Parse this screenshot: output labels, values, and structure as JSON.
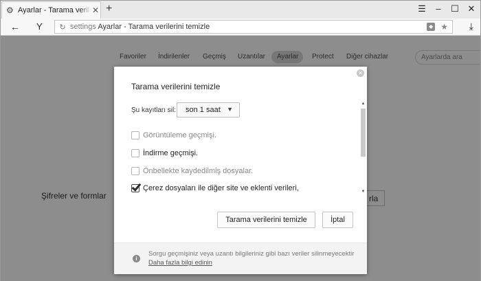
{
  "browser": {
    "tab_title": "Ayarlar - Tarama verilerini",
    "tab_icon": "gear-icon",
    "tab_close": "✕",
    "new_tab": "+",
    "window_controls": [
      "☰",
      "–",
      "☐",
      "✕"
    ],
    "back": "←",
    "yandex_logo": "Y",
    "url_host": "settings",
    "url_title": "Ayarlar - Tarama verilerini temizle",
    "download_icon": "⤓"
  },
  "settings_nav": {
    "items": [
      "Favoriler",
      "İndirilenler",
      "Geçmiş",
      "Uzantılar",
      "Ayarlar",
      "Protect",
      "Diğer cihazlar"
    ],
    "active": "Ayarlar",
    "search_placeholder": "Ayarlarda ara"
  },
  "background": {
    "section_label": "Şifreler ve formlar",
    "partial_button": "rla"
  },
  "dialog": {
    "title": "Tarama verilerini temizle",
    "period_label": "Şu kayıtları sil:",
    "period_value": "son 1 saat",
    "options": [
      {
        "label": "Görüntüleme geçmişi.",
        "checked": false
      },
      {
        "label": "İndirme geçmişi.",
        "checked": false
      },
      {
        "label": "Önbellekte kaydedilmiş dosyalar.",
        "checked": false
      },
      {
        "label": "Çerez dosyaları ile diğer site ve eklenti verileri,",
        "checked": true
      }
    ],
    "clear_button": "Tarama verilerini temizle",
    "cancel_button": "İptal",
    "footer_text": "Sorgu geçmişiniz veya uzantı bilgileriniz gibi bazı veriler silinmeyecektir",
    "footer_link": "Daha fazla bilgi edinin"
  }
}
